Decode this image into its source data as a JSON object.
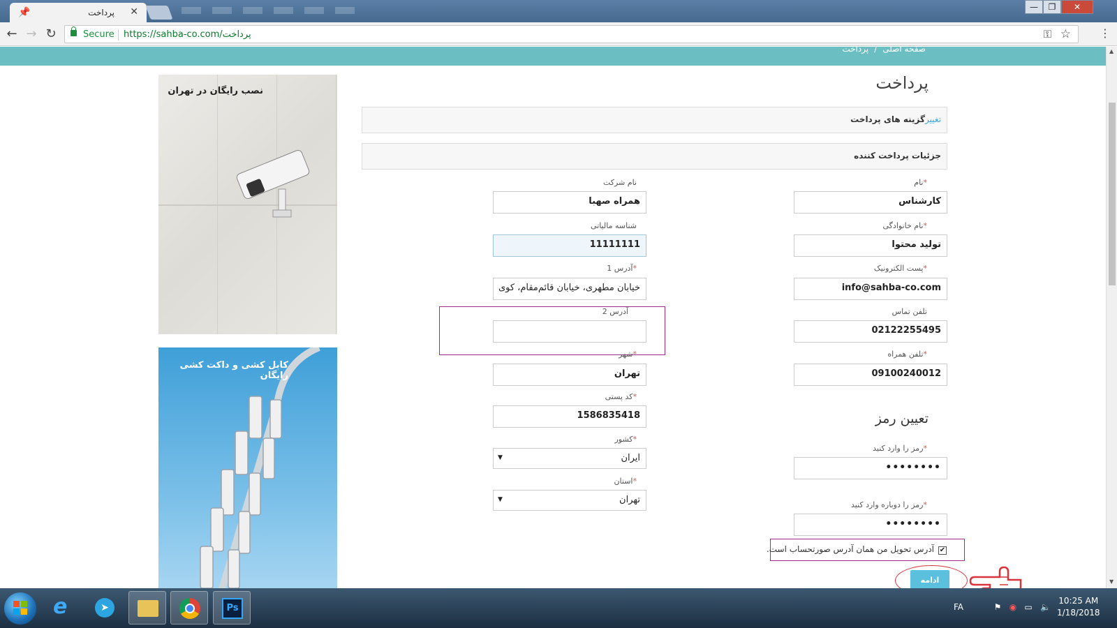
{
  "browser": {
    "tab_title": "پرداخت",
    "close_glyph": "✕",
    "secure_label": "Secure",
    "url": "https://sahba-co.com/پرداخت",
    "window_controls": {
      "minimize": "—",
      "maximize": "❐",
      "close": "✕"
    }
  },
  "breadcrumb": {
    "home": "صفحه اصلی",
    "separator": "/",
    "current": "پرداخت"
  },
  "page": {
    "title": "پرداخت",
    "payment_options": {
      "change_link": "تغییر",
      "label": "گزینه های پرداخت"
    },
    "payer_details": {
      "label": "جزئیات پرداخت کننده"
    }
  },
  "form": {
    "required_mark": "*",
    "first_name": {
      "label": "نام",
      "value": "کارشناس"
    },
    "last_name": {
      "label": "نام خانوادگی",
      "value": "تولید محتوا"
    },
    "email": {
      "label": "پست الکترونیک",
      "value": "info@sahba-co.com"
    },
    "phone": {
      "label": "تلفن تماس",
      "value": "02122255495"
    },
    "mobile": {
      "label": "تلفن همراه",
      "value": "09100240012"
    },
    "company": {
      "label": "نام شرکت",
      "value": "همراه صهبا"
    },
    "tax_id": {
      "label": "شناسه مالیاتی",
      "value": "11111111"
    },
    "address1": {
      "label": "آدرس 1",
      "value": "خیابان مطهری، خیابان قائم‌مقام، کوی"
    },
    "address2": {
      "label": "آدرس 2",
      "value": ""
    },
    "city": {
      "label": "شهر",
      "value": "تهران"
    },
    "postal_code": {
      "label": "کد پستی",
      "value": "1586835418"
    },
    "country": {
      "label": "کشور",
      "value": "ایران"
    },
    "province": {
      "label": "استان",
      "value": "تهران"
    },
    "password_section": "تعیین رمز",
    "password": {
      "label": "رمز را وارد کنید",
      "value": "••••••••"
    },
    "password_confirm": {
      "label": "رمز را دوباره وارد کنید",
      "value": "••••••••"
    },
    "same_address": {
      "label": "آدرس تحویل من همان آدرس صورتحساب است.",
      "checked": true,
      "check_glyph": "✔"
    },
    "continue_label": "ادامه"
  },
  "sidebar": {
    "banner1_caption": "نصب رایگان در تهران",
    "banner2_caption": "کابل کشی و داکت کشی رایگان"
  },
  "taskbar": {
    "lang": "FA",
    "time": "10:25 AM",
    "date": "1/18/2018",
    "ps_label": "Ps"
  },
  "colors": {
    "teal": "#6bbfc3",
    "accent_blue": "#5bc0de",
    "highlight": "#9b2c8d",
    "annotation_red": "#d9343a"
  }
}
